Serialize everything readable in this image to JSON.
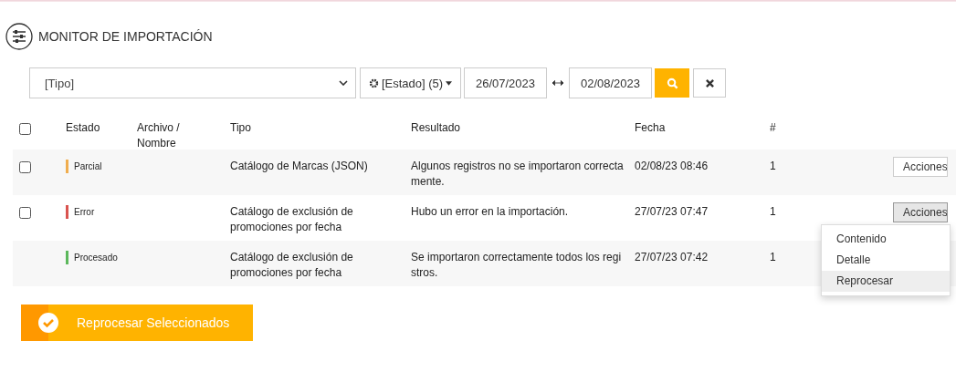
{
  "page": {
    "title": "MONITOR DE IMPORTACIÓN"
  },
  "filters": {
    "type_select": {
      "value": "[Tipo]"
    },
    "status_button": {
      "label": "[Estado] (5)"
    },
    "date_from": {
      "value": "26/07/2023"
    },
    "date_to": {
      "value": "02/08/2023"
    }
  },
  "table": {
    "header_checkbox": {
      "checked": false
    },
    "columns": [
      "Estado",
      "Archivo / Nombre",
      "Tipo",
      "Resultado",
      "Fecha",
      "#"
    ],
    "rows": [
      {
        "has_checkbox": true,
        "checked": false,
        "status": "Parcial",
        "color": "#f0ad4e",
        "tipo": "Catálogo de Marcas (JSON)",
        "resultado": "Algunos registros no se importaron correctamente.",
        "fecha": "02/08/23 08:46",
        "count": "1",
        "actions": {
          "label": "Acciones",
          "pressed": false
        }
      },
      {
        "has_checkbox": true,
        "checked": false,
        "status": "Error",
        "color": "#d9534f",
        "tipo": "Catálogo de exclusión de promociones por fecha",
        "resultado": "Hubo un error en la importación.",
        "fecha": "27/07/23 07:47",
        "count": "1",
        "actions": {
          "label": "Acciones",
          "pressed": true,
          "menu": [
            {
              "label": "Contenido",
              "selected": false
            },
            {
              "label": "Detalle",
              "selected": false
            },
            {
              "label": "Reprocesar",
              "selected": true
            }
          ]
        }
      },
      {
        "has_checkbox": false,
        "status": "Procesado",
        "color": "#5cb85c",
        "tipo": "Catálogo de exclusión de promociones por fecha",
        "resultado": "Se importaron correctamente todos los registros.",
        "fecha": "27/07/23 07:42",
        "count": "1",
        "actions": null
      }
    ]
  },
  "reprocess_button": {
    "label": "Reprocesar Seleccionados"
  }
}
